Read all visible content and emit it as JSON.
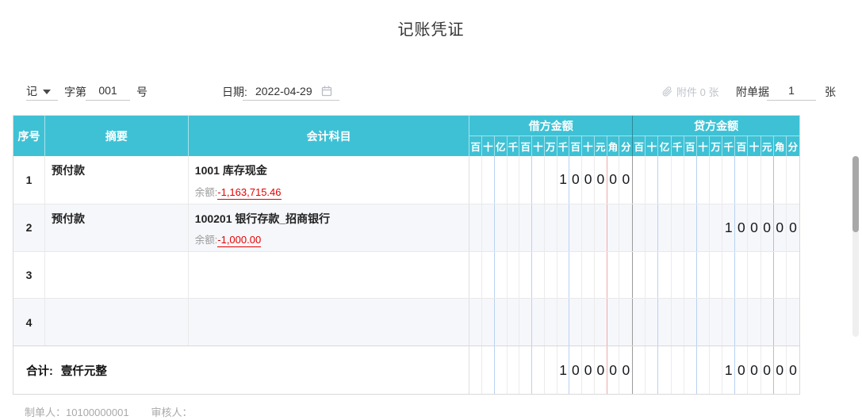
{
  "title": "记账凭证",
  "colors": {
    "header_teal": "#3ec1d5",
    "balance_red": "#e60000",
    "grid_blue": "#b9d2f2",
    "grid_red": "#f0a8a8",
    "disabled_gray": "#c0c4cc"
  },
  "controls": {
    "word_type": "记",
    "word_label": "字第",
    "number_value": "001",
    "number_suffix": "号",
    "date_label": "日期:",
    "date_value": "2022-04-29",
    "attachment_label": "附件 0 张",
    "receipts_label": "附单据",
    "receipts_value": "1",
    "receipts_suffix": "张"
  },
  "table": {
    "headers": {
      "index": "序号",
      "summary": "摘要",
      "account": "会计科目",
      "debit": "借方金额",
      "credit": "贷方金额"
    },
    "digit_labels": [
      "百",
      "十",
      "亿",
      "千",
      "百",
      "十",
      "万",
      "千",
      "百",
      "十",
      "元",
      "角",
      "分"
    ],
    "rows": [
      {
        "index": "1",
        "summary": "预付款",
        "account": "1001 库存现金",
        "balance_label": "余额:",
        "balance_value": "-1,163,715.46",
        "debit": [
          "",
          "",
          "",
          "",
          "",
          "",
          "",
          "1",
          "0",
          "0",
          "0",
          "0",
          "0"
        ],
        "credit": [
          "",
          "",
          "",
          "",
          "",
          "",
          "",
          "",
          "",
          "",
          "",
          "",
          ""
        ]
      },
      {
        "index": "2",
        "summary": "预付款",
        "account": "100201 银行存款_招商银行",
        "balance_label": "余额:",
        "balance_value": "-1,000.00",
        "debit": [
          "",
          "",
          "",
          "",
          "",
          "",
          "",
          "",
          "",
          "",
          "",
          "",
          ""
        ],
        "credit": [
          "",
          "",
          "",
          "",
          "",
          "",
          "",
          "1",
          "0",
          "0",
          "0",
          "0",
          "0"
        ]
      },
      {
        "index": "3",
        "summary": "",
        "account": "",
        "balance_label": "",
        "balance_value": "",
        "debit": [
          "",
          "",
          "",
          "",
          "",
          "",
          "",
          "",
          "",
          "",
          "",
          "",
          ""
        ],
        "credit": [
          "",
          "",
          "",
          "",
          "",
          "",
          "",
          "",
          "",
          "",
          "",
          "",
          ""
        ]
      },
      {
        "index": "4",
        "summary": "",
        "account": "",
        "balance_label": "",
        "balance_value": "",
        "debit": [
          "",
          "",
          "",
          "",
          "",
          "",
          "",
          "",
          "",
          "",
          "",
          "",
          ""
        ],
        "credit": [
          "",
          "",
          "",
          "",
          "",
          "",
          "",
          "",
          "",
          "",
          "",
          "",
          ""
        ]
      }
    ],
    "total": {
      "label": "合计:",
      "amount_in_words": "壹仟元整",
      "debit": [
        "",
        "",
        "",
        "",
        "",
        "",
        "",
        "1",
        "0",
        "0",
        "0",
        "0",
        "0"
      ],
      "credit": [
        "",
        "",
        "",
        "",
        "",
        "",
        "",
        "1",
        "0",
        "0",
        "0",
        "0",
        "0"
      ]
    }
  },
  "footer": {
    "creator_label": "制单人：",
    "creator_value": "10100000001",
    "auditor_label": "审核人："
  }
}
